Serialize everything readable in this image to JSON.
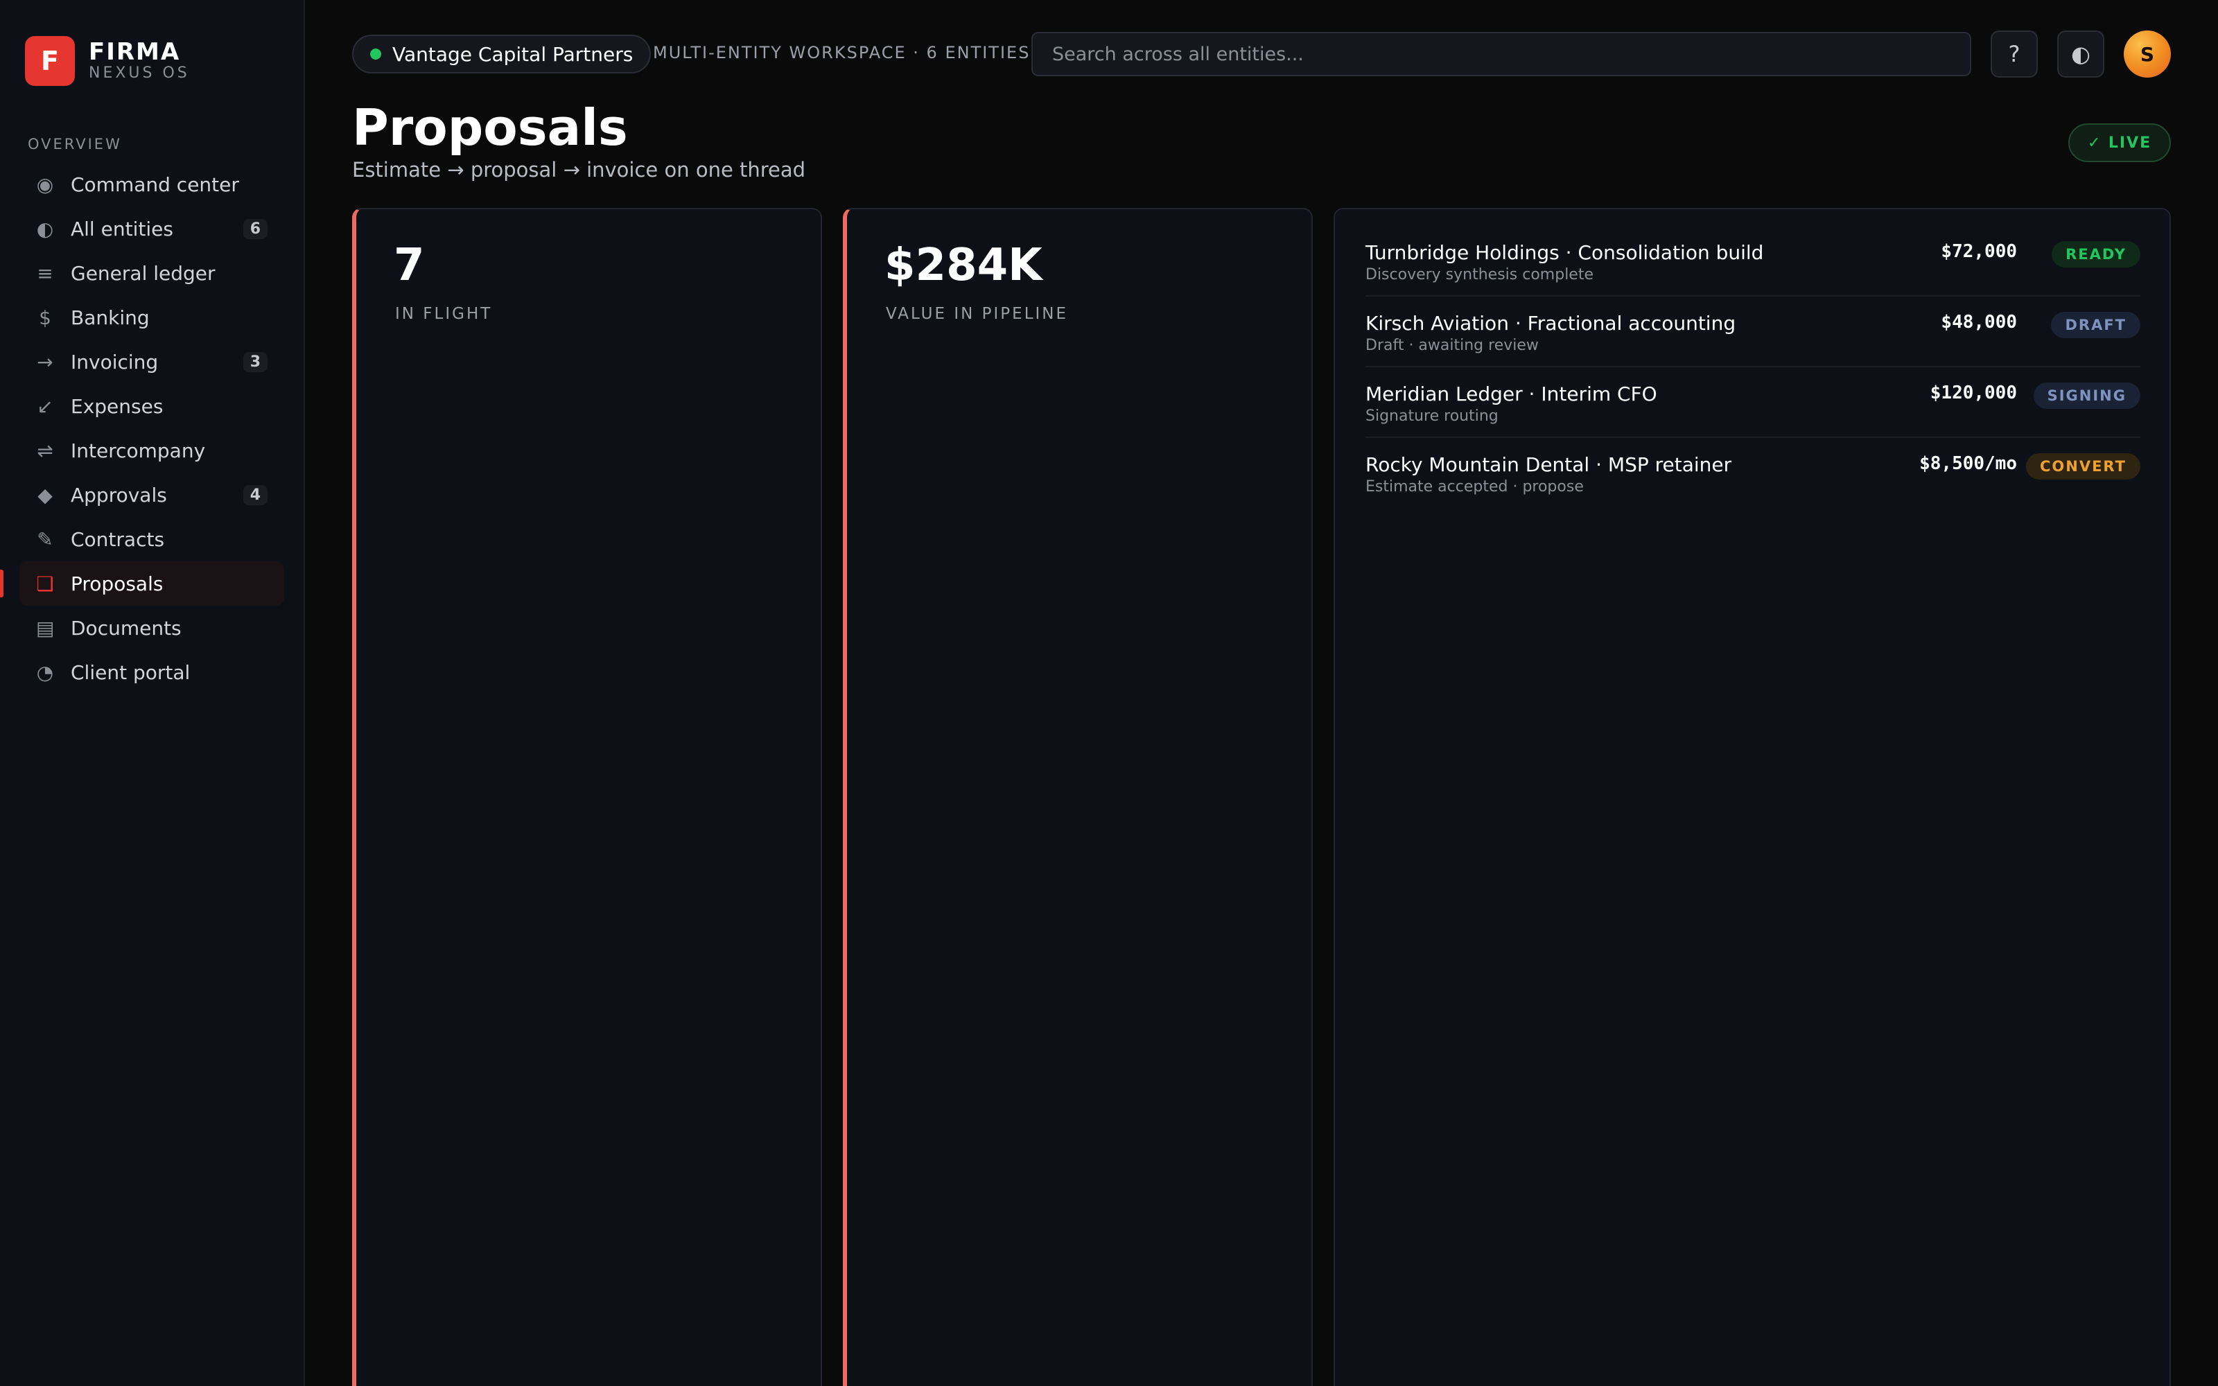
{
  "brand": {
    "logo_letter": "F",
    "name": "FIRMA",
    "subtitle": "NEXUS OS"
  },
  "sidebar": {
    "section_label": "OVERVIEW",
    "items": [
      {
        "label": "Command center",
        "icon": "target-icon",
        "glyph": "◉",
        "count": null,
        "active": false
      },
      {
        "label": "All entities",
        "icon": "half-circle-icon",
        "glyph": "◐",
        "count": "6",
        "active": false
      },
      {
        "label": "General ledger",
        "icon": "lines-icon",
        "glyph": "≡",
        "count": null,
        "active": false
      },
      {
        "label": "Banking",
        "icon": "dollar-icon",
        "glyph": "$",
        "count": null,
        "active": false
      },
      {
        "label": "Invoicing",
        "icon": "arrow-right-icon",
        "glyph": "→",
        "count": "3",
        "active": false
      },
      {
        "label": "Expenses",
        "icon": "arrow-down-left-icon",
        "glyph": "↙",
        "count": null,
        "active": false
      },
      {
        "label": "Intercompany",
        "icon": "swap-icon",
        "glyph": "⇌",
        "count": null,
        "active": false
      },
      {
        "label": "Approvals",
        "icon": "diamond-icon",
        "glyph": "◆",
        "count": "4",
        "active": false
      },
      {
        "label": "Contracts",
        "icon": "pen-icon",
        "glyph": "✎",
        "count": null,
        "active": false
      },
      {
        "label": "Proposals",
        "icon": "square-icon",
        "glyph": "❑",
        "count": null,
        "active": true
      },
      {
        "label": "Documents",
        "icon": "document-icon",
        "glyph": "▤",
        "count": null,
        "active": false
      },
      {
        "label": "Client portal",
        "icon": "quarter-circle-icon",
        "glyph": "◔",
        "count": null,
        "active": false
      }
    ]
  },
  "topbar": {
    "entity_name": "Vantage Capital Partners",
    "entity_status_color": "#22c55e",
    "workspace_label": "MULTI-ENTITY WORKSPACE · 6 ENTITIES",
    "search_placeholder": "Search across all entities...",
    "help_glyph": "?",
    "theme_glyph": "◐",
    "avatar_initial": "S"
  },
  "header": {
    "title": "Proposals",
    "subtitle": "Estimate → proposal → invoice on one thread",
    "live_badge": "✓ LIVE"
  },
  "stats": [
    {
      "value": "7",
      "label": "IN FLIGHT"
    },
    {
      "value": "$284K",
      "label": "VALUE IN PIPELINE"
    }
  ],
  "proposals": [
    {
      "title": "Turnbridge Holdings · Consolidation build",
      "subtitle": "Discovery synthesis complete",
      "amount": "$72,000",
      "status": "READY",
      "status_color": "#22c55e",
      "status_bg": "#0f2a18"
    },
    {
      "title": "Kirsch Aviation · Fractional accounting",
      "subtitle": "Draft · awaiting review",
      "amount": "$48,000",
      "status": "DRAFT",
      "status_color": "#7f93c0",
      "status_bg": "#1a2235"
    },
    {
      "title": "Meridian Ledger · Interim CFO",
      "subtitle": "Signature routing",
      "amount": "$120,000",
      "status": "SIGNING",
      "status_color": "#7f93c0",
      "status_bg": "#1a2235"
    },
    {
      "title": "Rocky Mountain Dental · MSP retainer",
      "subtitle": "Estimate accepted · propose",
      "amount": "$8,500/mo",
      "status": "CONVERT",
      "status_color": "#f0a030",
      "status_bg": "#2e2412"
    }
  ],
  "colors": {
    "accent": "#e5362f",
    "card_accent": "#ef6b5f",
    "live": "#22c55e"
  }
}
